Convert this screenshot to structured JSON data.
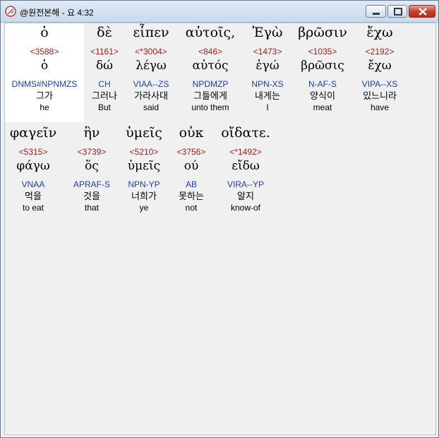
{
  "window": {
    "title": "@원전본해 - 요 4:32",
    "icons": {
      "app": "bible-app-icon",
      "minimize": "minimize-icon",
      "maximize": "maximize-icon",
      "close": "close-icon"
    },
    "colors": {
      "strong": "#9b1b1b",
      "morph": "#1f3ea8",
      "selection": "#ffffff",
      "background": "#f0f0f0"
    }
  },
  "rows": [
    {
      "words": [
        {
          "greek": "ὁ",
          "strong": "<3588>",
          "lemma": "ὁ",
          "morph": "DNMS#NPNMZS",
          "korean": "그가",
          "english": "he"
        },
        {
          "greek": "δὲ",
          "strong": "<1161>",
          "lemma": "δώ",
          "morph": "CH",
          "korean": "그러나",
          "english": "But"
        },
        {
          "greek": "εἶπεν",
          "strong": "<*3004>",
          "lemma": "λέγω",
          "morph": "VIAA--ZS",
          "korean": "가라사대",
          "english": "said"
        },
        {
          "greek": "αὐτοῖς,",
          "strong": "<846>",
          "lemma": "αὐτός",
          "morph": "NPDMZP",
          "korean": "그들에게",
          "english": "unto them"
        },
        {
          "greek": "Ἐγὼ",
          "strong": "<1473>",
          "lemma": "ἐγώ",
          "morph": "NPN-XS",
          "korean": "내게는",
          "english": "I"
        },
        {
          "greek": "βρῶσιν",
          "strong": "<1035>",
          "lemma": "βρῶσις",
          "morph": "N-AF-S",
          "korean": "양식이",
          "english": "meat"
        },
        {
          "greek": "ἔχω",
          "strong": "<2192>",
          "lemma": "ἔχω",
          "morph": "VIPA--XS",
          "korean": "있느니라",
          "english": "have"
        }
      ]
    },
    {
      "words": [
        {
          "greek": "φαγεῖν",
          "strong": "<5315>",
          "lemma": "φάγω",
          "morph": "VNAA",
          "korean": "먹을",
          "english": "to eat"
        },
        {
          "greek": "ἣν",
          "strong": "<3739>",
          "lemma": "ὅς",
          "morph": "APRAF-S",
          "korean": "것을",
          "english": "that"
        },
        {
          "greek": "ὑμεῖς",
          "strong": "<5210>",
          "lemma": "ὑμεῖς",
          "morph": "NPN-YP",
          "korean": "너희가",
          "english": "ye"
        },
        {
          "greek": "οὐκ",
          "strong": "<3756>",
          "lemma": "ού",
          "morph": "AB",
          "korean": "못하는",
          "english": "not"
        },
        {
          "greek": "οἴδατε.",
          "strong": "<*1492>",
          "lemma": "εἴδω",
          "morph": "VIRA--YP",
          "korean": "알지",
          "english": "know-of"
        }
      ]
    }
  ]
}
